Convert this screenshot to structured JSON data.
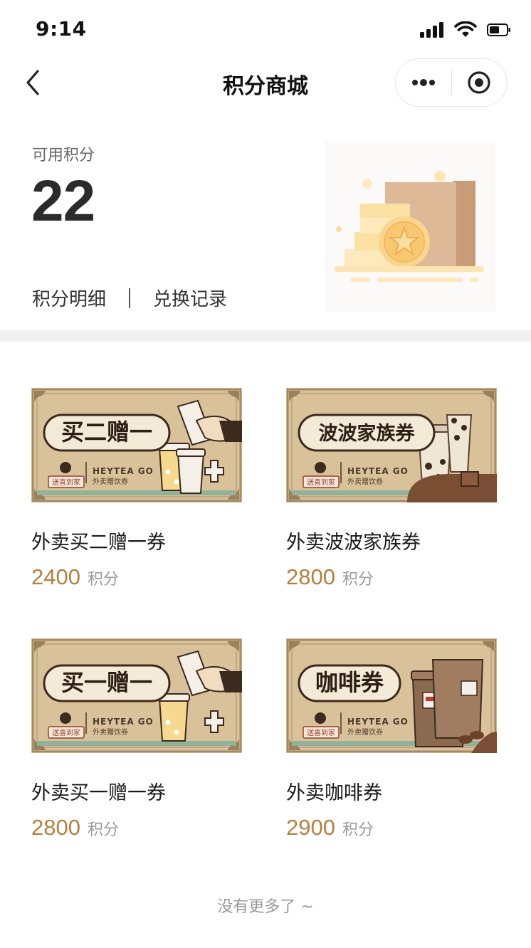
{
  "status_bar": {
    "time": "9:14"
  },
  "nav": {
    "title": "积分商城"
  },
  "points": {
    "label": "可用积分",
    "value": "22",
    "detail_link": "积分明细",
    "record_link": "兑换记录"
  },
  "products": [
    {
      "name": "外卖买二赠一券",
      "price": "2400",
      "unit": "积分",
      "coupon_title": "买二赠一",
      "brand": "HEYTEA GO",
      "brand_sub": "外卖赠饮券",
      "stamp": "送喜到家"
    },
    {
      "name": "外卖波波家族券",
      "price": "2800",
      "unit": "积分",
      "coupon_title": "波波家族券",
      "brand": "HEYTEA GO",
      "brand_sub": "外卖赠饮券",
      "stamp": "送喜到家"
    },
    {
      "name": "外卖买一赠一券",
      "price": "2800",
      "unit": "积分",
      "coupon_title": "买一赠一",
      "brand": "HEYTEA GO",
      "brand_sub": "外卖赠饮券",
      "stamp": "送喜到家"
    },
    {
      "name": "外卖咖啡券",
      "price": "2900",
      "unit": "积分",
      "coupon_title": "咖啡券",
      "brand": "HEYTEA GO",
      "brand_sub": "外卖赠饮券",
      "stamp": "送喜到家"
    }
  ],
  "footer": {
    "note": "没有更多了 ~"
  },
  "colors": {
    "price": "#b5803a",
    "coupon_bg": "#d9c29a",
    "coupon_border": "#a58a63",
    "accent_green": "#8fb29a"
  }
}
